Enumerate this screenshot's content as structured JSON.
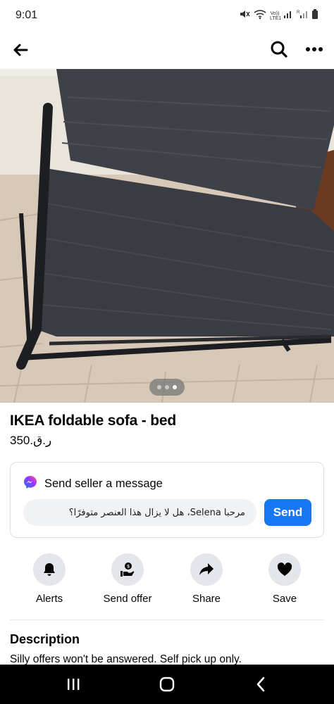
{
  "status_bar": {
    "time": "9:01",
    "icons": [
      "mute-icon",
      "wifi-icon",
      "volte-icon",
      "signal-icon",
      "signal-r-icon",
      "battery-icon"
    ],
    "volte_text": "Vo)) LTE1"
  },
  "nav": {
    "back_icon": "arrow-left-icon",
    "search_icon": "search-icon",
    "more_icon": "more-horizontal-icon"
  },
  "photo": {
    "description_icon": "product-photo",
    "page_count": 3,
    "active_page": 3
  },
  "listing": {
    "title": "IKEA foldable sofa - bed",
    "price": "ر.ق.350"
  },
  "message": {
    "header_icon": "messenger-icon",
    "header_label": "Send seller a message",
    "input_value": "مرحبا Selena، هل لا يزال هذا العنصر متوفرًا؟",
    "send_label": "Send"
  },
  "actions": [
    {
      "icon": "bell-icon",
      "label": "Alerts"
    },
    {
      "icon": "send-offer-icon",
      "label": "Send offer"
    },
    {
      "icon": "share-arrow-icon",
      "label": "Share"
    },
    {
      "icon": "heart-icon",
      "label": "Save"
    }
  ],
  "description": {
    "heading": "Description",
    "text": "Silly offers won't be answered. Self pick up only."
  },
  "colors": {
    "accent": "#1877f2",
    "action_bg": "#e4e6eb",
    "input_bg": "#f0f2f5"
  }
}
